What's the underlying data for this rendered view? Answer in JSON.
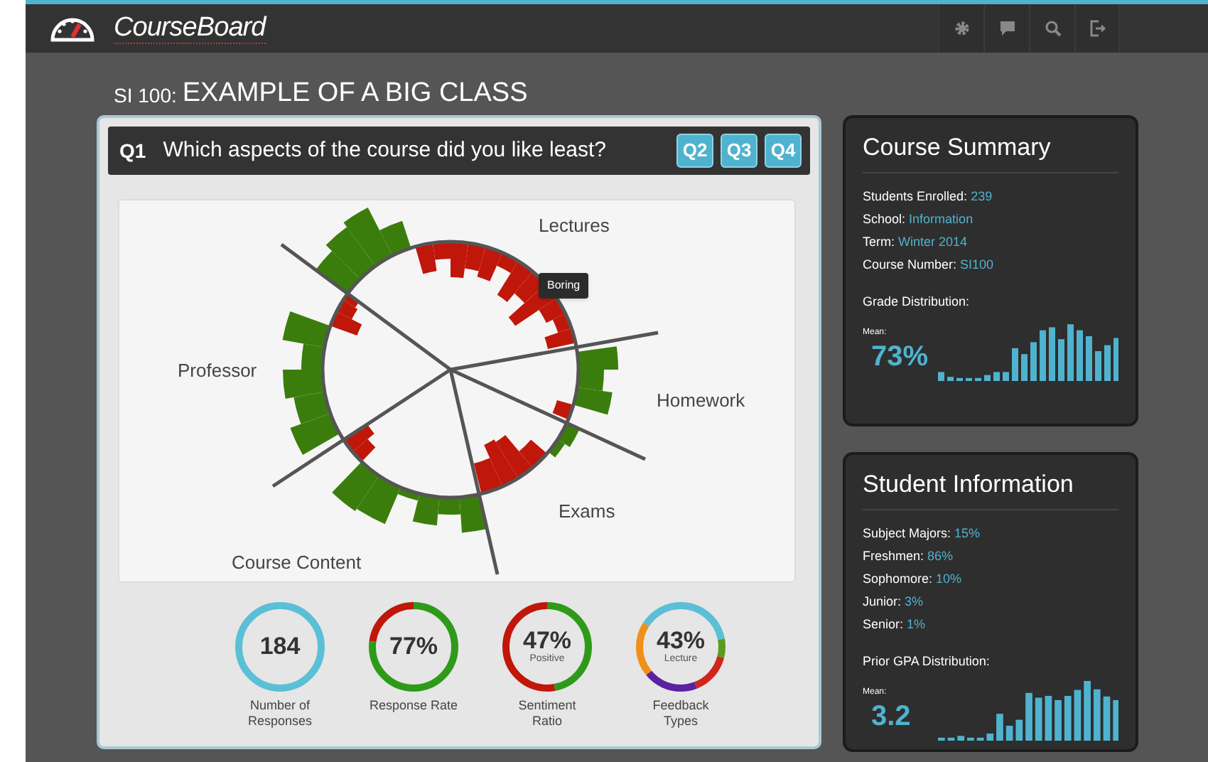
{
  "header": {
    "logo": "CourseBoard"
  },
  "page_title": {
    "prefix": "SI 100:",
    "title": "EXAMPLE OF A BIG CLASS"
  },
  "question": {
    "number": "Q1",
    "text": "Which aspects of the course did you like least?",
    "buttons": [
      "Q2",
      "Q3",
      "Q4"
    ]
  },
  "chart": {
    "segment_labels": [
      "Lectures",
      "Homework",
      "Exams",
      "Course Content",
      "Professor"
    ],
    "tooltip": "Boring"
  },
  "metrics": [
    {
      "kind": "single",
      "value": "184",
      "caption": "Number of\nResponses"
    },
    {
      "kind": "split",
      "value": "77%",
      "level": 0.77,
      "caption": "Response Rate"
    },
    {
      "kind": "split",
      "value": "47%",
      "sublabel": "Positive",
      "level": 0.47,
      "caption": "Sentiment\nRatio"
    },
    {
      "kind": "multi",
      "value": "43%",
      "sublabel": "Lecture",
      "caption": "Feedback\nTypes"
    }
  ],
  "course_summary": {
    "title": "Course Summary",
    "facts": [
      {
        "label": "Students Enrolled:",
        "value": "239"
      },
      {
        "label": "School:",
        "value": "Information"
      },
      {
        "label": "Term:",
        "value": "Winter 2014"
      },
      {
        "label": "Course Number:",
        "value": "SI100"
      }
    ],
    "distribution": {
      "label": "Grade Distribution:",
      "mean_label": "Mean:",
      "mean": "73%"
    }
  },
  "student_information": {
    "title": "Student Information",
    "facts": [
      {
        "label": "Subject Majors:",
        "value": "15%"
      },
      {
        "label": "Freshmen:",
        "value": "86%"
      },
      {
        "label": "Sophomore:",
        "value": "10%"
      },
      {
        "label": "Junior:",
        "value": "3%"
      },
      {
        "label": "Senior:",
        "value": "1%"
      }
    ],
    "distribution": {
      "label": "Prior GPA Distribution:",
      "mean_label": "Mean:",
      "mean": "3.2"
    }
  }
}
